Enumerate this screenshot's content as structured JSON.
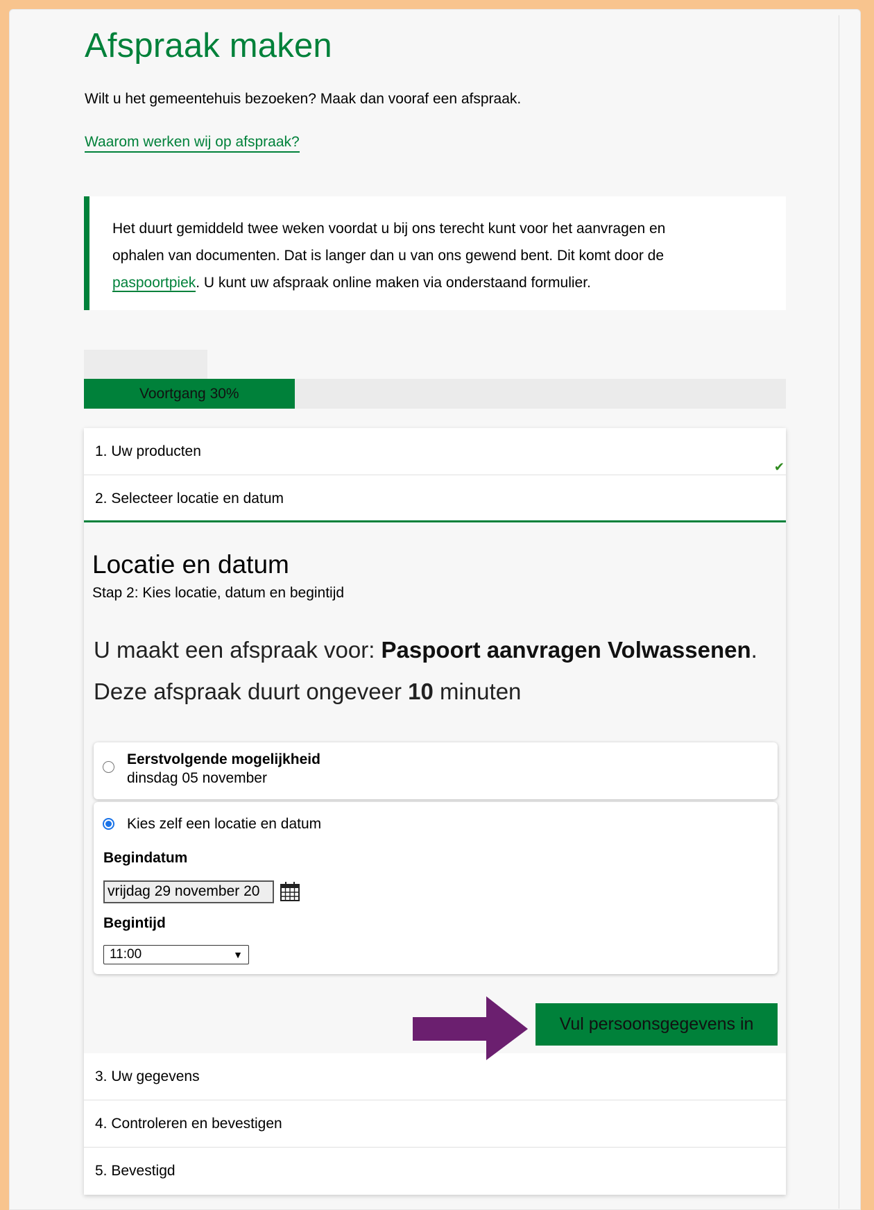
{
  "page": {
    "title": "Afspraak maken",
    "intro": "Wilt u het gemeentehuis bezoeken? Maak dan vooraf een afspraak.",
    "why_link": "Waarom werken wij op afspraak?"
  },
  "notice": {
    "line1": "Het duurt gemiddeld twee weken voordat u bij ons terecht kunt voor het aanvragen en",
    "line2": "ophalen van documenten. Dat is langer dan u van ons gewend bent. Dit komt door de",
    "link": "paspoortpiek",
    "line3_rest": ". U kunt uw afspraak online maken via onderstaand formulier."
  },
  "progress": {
    "label": "Voortgang 30%",
    "percent": 30,
    "fill_color": "#00813a"
  },
  "steps": [
    {
      "label": "1. Uw producten",
      "completed": true
    },
    {
      "label": "2. Selecteer locatie en datum",
      "active": true
    },
    {
      "label": "3. Uw gegevens"
    },
    {
      "label": "4. Controleren en bevestigen"
    },
    {
      "label": "5. Bevestigd"
    }
  ],
  "panel": {
    "heading": "Locatie en datum",
    "subheading": "Stap 2: Kies locatie, datum en begintijd",
    "appointment_prefix": "U maakt een afspraak voor: ",
    "appointment_product": "Paspoort aanvragen Volwassenen",
    "appointment_suffix": ".",
    "duration_prefix": "Deze afspraak duurt ongeveer ",
    "duration_value": "10",
    "duration_suffix": " minuten",
    "option_next": {
      "title": "Eerstvolgende mogelijkheid",
      "date": "dinsdag 05 november",
      "selected": false
    },
    "option_choose": {
      "label": "Kies zelf een locatie en datum",
      "selected": true
    },
    "begindatum_label": "Begindatum",
    "begindatum_value": "vrijdag 29 november 20",
    "begintijd_label": "Begintijd",
    "begintijd_value": "11:00",
    "cta": "Vul persoonsgegevens in"
  },
  "colors": {
    "brand_green": "#00813a",
    "annotation_arrow": "#6b1f6f",
    "outer_frame": "#f8c48e"
  },
  "icons": [
    "calendar-icon",
    "checkmark-icon",
    "chevron-down-icon",
    "annotation-arrow"
  ]
}
